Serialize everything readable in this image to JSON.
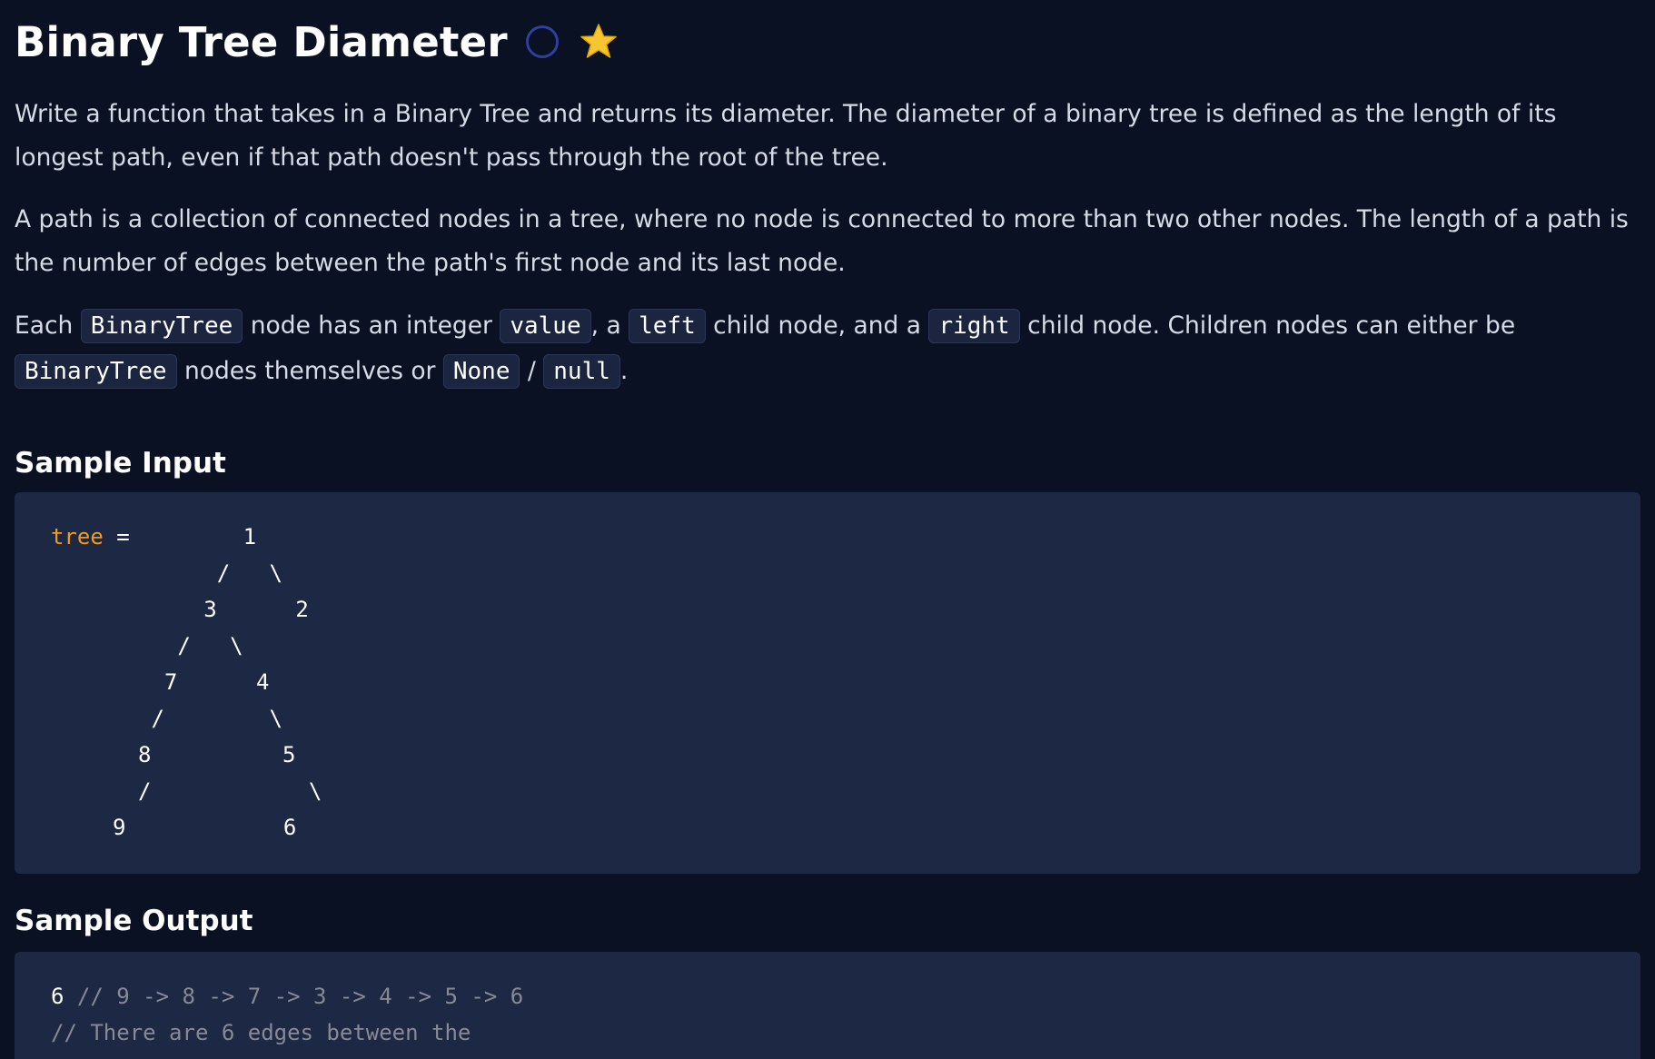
{
  "problem": {
    "title": "Binary Tree Diameter",
    "status_icon": "empty-circle-icon",
    "favorite_icon": "star-icon"
  },
  "description": {
    "p1": "Write a function that takes in a Binary Tree and returns its diameter. The diameter of a binary tree is defined as the length of its longest path, even if that path doesn't pass through the root of the tree.",
    "p2": "A path is a collection of connected nodes in a tree, where no node is connected to more than two other nodes. The length of a path is the number of edges between the path's first node and its last node.",
    "p3": {
      "t1": "Each ",
      "c1": "BinaryTree",
      "t2": " node has an integer ",
      "c2": "value",
      "t3": ", a ",
      "c3": "left",
      "t4": " child node, and a ",
      "c4": "right",
      "t5": " child node. Children nodes can either be ",
      "c5": "BinaryTree",
      "t6": " nodes themselves or ",
      "c6": "None",
      "t7": " / ",
      "c7": "null",
      "t8": "."
    }
  },
  "sample_input": {
    "heading": "Sample Input",
    "var_name": "tree",
    "assign": " =",
    "tree_lines": [
      "        1",
      "      /   \\",
      "     3      2",
      "   /   \\",
      "  7      4",
      " /        \\",
      "8          5",
      "/            \\",
      "9            6"
    ]
  },
  "sample_output": {
    "heading": "Sample Output",
    "value": "6",
    "comment1": " // 9 -> 8 -> 7 -> 3 -> 4 -> 5 -> 6",
    "comment2": "// There are 6 edges between the"
  }
}
